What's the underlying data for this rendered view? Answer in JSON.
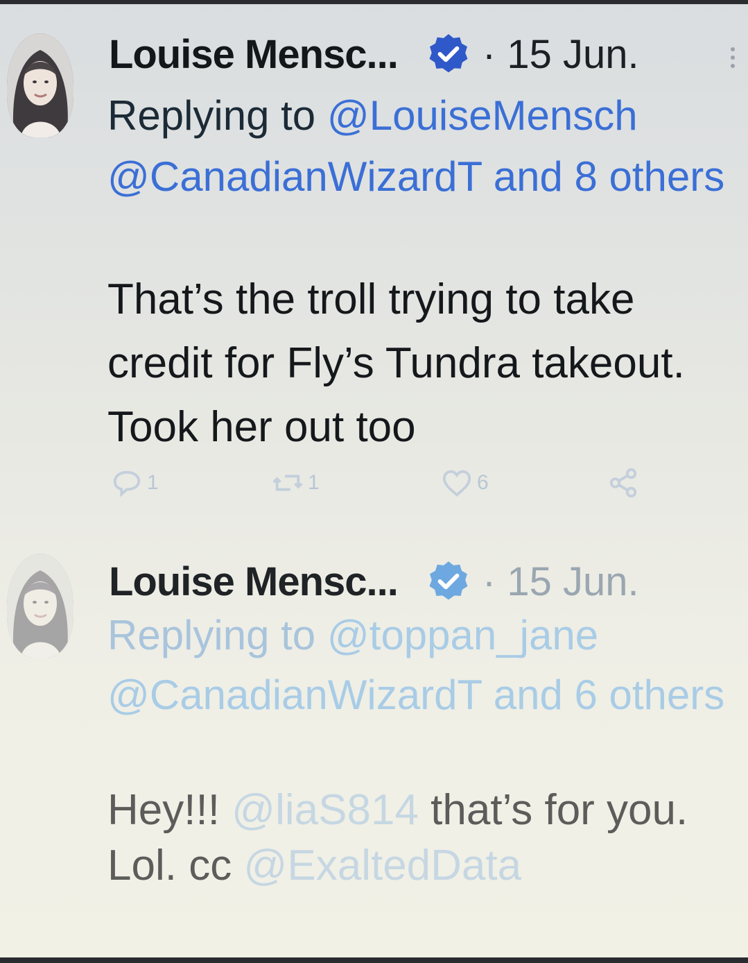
{
  "tweets": [
    {
      "author": "Louise Mensc...",
      "date": "· 15 Jun.",
      "reply_prefix": "Replying to ",
      "reply_mention_1": "@LouiseMensch",
      "reply_mention_2": "@CanadianWizardT and 8 others",
      "body": "That’s the troll trying to take credit for Fly’s Tundra takeout. Took her out too",
      "replies": "1",
      "retweets": "1",
      "likes": "6"
    },
    {
      "author": "Louise Mensc...",
      "date": "· 15 Jun.",
      "reply_prefix": "Replying to ",
      "reply_mention_1": "@toppan_jane",
      "reply_mention_2": "@CanadianWizardT and 6 others",
      "body_part_1": "Hey!!! ",
      "body_mention_1": "@liaS814",
      "body_part_2": " that’s for you. Lol. cc ",
      "body_mention_2": "@ExaltedData"
    }
  ],
  "colors": {
    "link": "#3b6fd6",
    "verified": "#2f58c9",
    "text": "#14171a"
  },
  "icons": [
    "verified-icon",
    "more-icon",
    "reply-icon",
    "retweet-icon",
    "like-icon",
    "share-icon"
  ]
}
